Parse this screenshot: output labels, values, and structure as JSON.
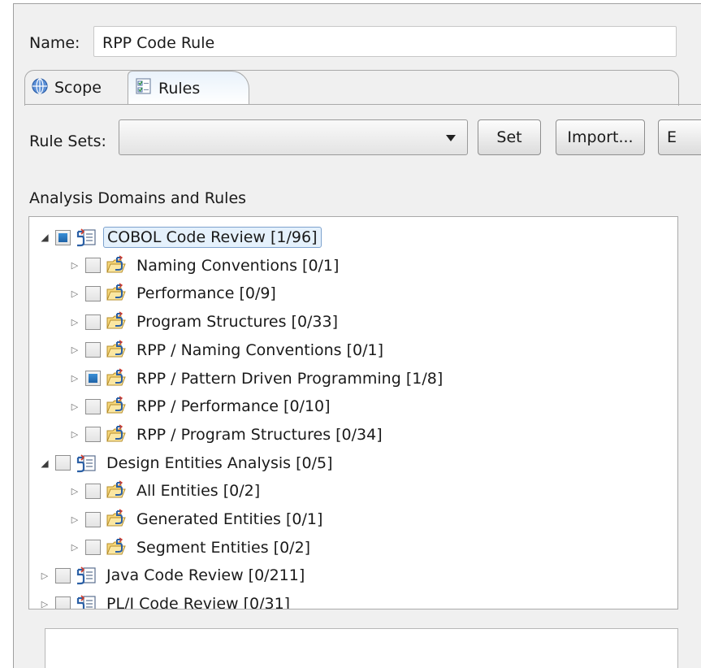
{
  "name_field": {
    "label": "Name:",
    "value": "RPP Code Rule"
  },
  "tabs": [
    {
      "label": "Scope",
      "icon": "globe-icon",
      "active": false
    },
    {
      "label": "Rules",
      "icon": "rules-checklist-icon",
      "active": true
    }
  ],
  "rule_sets": {
    "label": "Rule Sets:",
    "selected": "",
    "buttons": {
      "set": "Set",
      "import": "Import...",
      "export": "E"
    }
  },
  "analysis": {
    "label": "Analysis Domains and Rules",
    "tree": [
      {
        "label": "COBOL Code Review [1/96]",
        "level": 0,
        "expanded": true,
        "check": "partial",
        "icon": "code-review-icon",
        "selected": true
      },
      {
        "label": "Naming Conventions [0/1]",
        "level": 1,
        "expanded": false,
        "check": "none",
        "icon": "folder-rule-icon"
      },
      {
        "label": "Performance [0/9]",
        "level": 1,
        "expanded": false,
        "check": "none",
        "icon": "folder-rule-icon"
      },
      {
        "label": "Program Structures [0/33]",
        "level": 1,
        "expanded": false,
        "check": "none",
        "icon": "folder-rule-icon"
      },
      {
        "label": "RPP / Naming Conventions [0/1]",
        "level": 1,
        "expanded": false,
        "check": "none",
        "icon": "folder-rule-icon"
      },
      {
        "label": "RPP / Pattern Driven Programming [1/8]",
        "level": 1,
        "expanded": false,
        "check": "partial",
        "icon": "folder-rule-icon"
      },
      {
        "label": "RPP / Performance [0/10]",
        "level": 1,
        "expanded": false,
        "check": "none",
        "icon": "folder-rule-icon"
      },
      {
        "label": "RPP / Program Structures [0/34]",
        "level": 1,
        "expanded": false,
        "check": "none",
        "icon": "folder-rule-icon"
      },
      {
        "label": "Design Entities Analysis [0/5]",
        "level": 0,
        "expanded": true,
        "check": "none",
        "icon": "code-review-icon"
      },
      {
        "label": "All Entities [0/2]",
        "level": 1,
        "expanded": false,
        "check": "none",
        "icon": "folder-rule-icon"
      },
      {
        "label": "Generated Entities [0/1]",
        "level": 1,
        "expanded": false,
        "check": "none",
        "icon": "folder-rule-icon"
      },
      {
        "label": "Segment Entities [0/2]",
        "level": 1,
        "expanded": false,
        "check": "none",
        "icon": "folder-rule-icon"
      },
      {
        "label": "Java Code Review [0/211]",
        "level": 0,
        "expanded": false,
        "check": "none",
        "icon": "code-review-icon"
      },
      {
        "label": "PL/I Code Review [0/31]",
        "level": 0,
        "expanded": false,
        "check": "none",
        "icon": "code-review-icon"
      }
    ]
  },
  "colors": {
    "selection_bg": "#e5f1fc",
    "selection_border": "#7da2ce",
    "check_fill": "#1f63a8",
    "panel_bg": "#f0f0f0"
  }
}
